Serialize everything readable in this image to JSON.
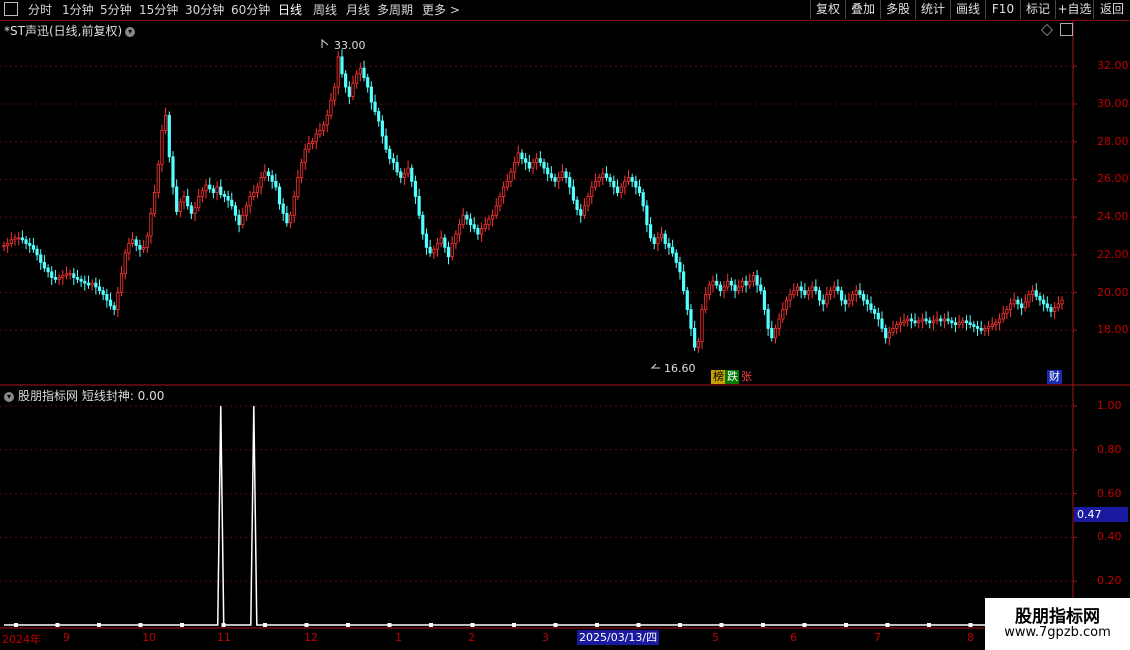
{
  "toolbar": {
    "left_items": [
      {
        "label": "分时",
        "active": false
      },
      {
        "label": "1分钟",
        "active": false
      },
      {
        "label": "5分钟",
        "active": false
      },
      {
        "label": "15分钟",
        "active": false
      },
      {
        "label": "30分钟",
        "active": false
      },
      {
        "label": "60分钟",
        "active": false
      },
      {
        "label": "日线",
        "active": true
      },
      {
        "label": "周线",
        "active": false
      },
      {
        "label": "月线",
        "active": false
      },
      {
        "label": "多周期",
        "active": false
      },
      {
        "label": "更多",
        "active": false
      }
    ],
    "right_buttons": [
      "复权",
      "叠加",
      "多股",
      "统计",
      "画线",
      "F10",
      "标记",
      "+自选",
      "返回"
    ]
  },
  "main_chart": {
    "title": "*ST声迅(日线,前复权)",
    "y_ticks": [
      "32.00",
      "30.00",
      "28.00",
      "26.00",
      "24.00",
      "22.00",
      "20.00",
      "18.00"
    ],
    "high_label": "33.00",
    "low_label": "16.60",
    "badge_bang": "榜",
    "badge_die": "跌",
    "badge_zhang": "张",
    "badge_cai": "财"
  },
  "indicator": {
    "title": "股朋指标网  短线封神: 0.00",
    "y_ticks": [
      "1.00",
      "0.80",
      "0.60",
      "0.40",
      "0.20"
    ],
    "current_value": "0.47"
  },
  "date_axis": {
    "labels": [
      "2024年",
      "9",
      "10",
      "11",
      "12",
      "1",
      "2",
      "3",
      "5",
      "6",
      "7",
      "8"
    ],
    "highlight": "2025/03/13/四"
  },
  "watermark": {
    "name": "股朋指标网",
    "url": "www.7gpzb.com"
  },
  "colors": {
    "up": "#ff3333",
    "down": "#54ffff",
    "grid": "#7a1010",
    "line": "#ffffff"
  },
  "chart_data": {
    "type": "candlestick",
    "ylim": [
      16.0,
      33.5
    ],
    "series": [
      {
        "name": "price",
        "values": [
          22.5,
          22.6,
          22.8,
          22.9,
          22.9,
          22.8,
          22.6,
          22.5,
          22.3,
          22.0,
          21.6,
          21.3,
          21.1,
          20.8,
          20.7,
          20.8,
          20.9,
          21.0,
          21.0,
          20.8,
          20.7,
          20.6,
          20.5,
          20.4,
          20.5,
          20.3,
          20.1,
          19.9,
          19.6,
          19.3,
          19.1,
          20.0,
          21.0,
          22.1,
          22.6,
          22.8,
          22.5,
          22.3,
          22.4,
          23.0,
          24.2,
          25.3,
          26.8,
          28.6,
          29.4,
          27.2,
          25.6,
          24.3,
          24.8,
          25.1,
          24.6,
          24.2,
          24.5,
          25.1,
          25.4,
          25.7,
          25.5,
          25.3,
          25.6,
          25.2,
          25.1,
          24.9,
          24.6,
          24.1,
          23.6,
          24.1,
          24.6,
          25.1,
          25.3,
          25.6,
          26.1,
          26.4,
          26.2,
          25.9,
          25.6,
          24.7,
          24.2,
          23.7,
          24.1,
          25.1,
          26.1,
          26.9,
          27.6,
          27.9,
          28.0,
          28.4,
          28.6,
          28.9,
          29.4,
          30.2,
          30.9,
          32.5,
          31.6,
          30.9,
          30.4,
          31.1,
          31.6,
          31.9,
          31.4,
          30.9,
          30.1,
          29.6,
          29.1,
          28.3,
          27.6,
          27.1,
          26.9,
          26.4,
          26.1,
          26.3,
          26.6,
          25.9,
          25.1,
          24.1,
          23.1,
          22.4,
          22.1,
          22.3,
          22.6,
          22.9,
          22.4,
          21.9,
          22.6,
          23.1,
          23.6,
          24.1,
          23.9,
          23.6,
          23.4,
          23.1,
          23.4,
          23.6,
          23.9,
          24.1,
          24.6,
          25.1,
          25.6,
          25.9,
          26.4,
          26.9,
          27.4,
          27.1,
          26.9,
          26.6,
          26.9,
          27.1,
          26.9,
          26.6,
          26.3,
          26.1,
          25.9,
          26.1,
          26.4,
          26.1,
          25.6,
          24.9,
          24.4,
          24.1,
          24.6,
          25.1,
          25.6,
          25.9,
          26.1,
          26.3,
          26.1,
          25.9,
          25.6,
          25.3,
          25.6,
          25.9,
          26.1,
          25.9,
          25.6,
          25.3,
          24.6,
          23.6,
          22.9,
          22.6,
          22.9,
          23.1,
          22.6,
          22.4,
          22.1,
          21.6,
          21.1,
          20.1,
          19.1,
          18.1,
          17.1,
          17.4,
          19.1,
          19.9,
          20.4,
          20.6,
          20.4,
          20.1,
          20.3,
          20.6,
          20.4,
          20.1,
          20.3,
          20.6,
          20.4,
          20.6,
          20.9,
          20.4,
          20.1,
          19.1,
          18.1,
          17.6,
          18.1,
          18.6,
          19.1,
          19.6,
          19.9,
          20.1,
          20.3,
          20.1,
          19.9,
          20.1,
          20.3,
          20.1,
          19.6,
          19.4,
          19.9,
          20.1,
          20.3,
          20.1,
          19.6,
          19.4,
          19.6,
          19.9,
          20.1,
          19.9,
          19.6,
          19.4,
          19.1,
          18.9,
          18.6,
          18.1,
          17.6,
          17.9,
          18.1,
          18.3,
          18.4,
          18.5,
          18.6,
          18.5,
          18.4,
          18.5,
          18.6,
          18.5,
          18.4,
          18.5,
          18.6,
          18.5,
          18.6,
          18.5,
          18.4,
          18.3,
          18.4,
          18.5,
          18.4,
          18.3,
          18.2,
          18.1,
          18.0,
          18.1,
          18.2,
          18.3,
          18.4,
          18.6,
          18.9,
          19.1,
          19.4,
          19.6,
          19.4,
          19.2,
          19.5,
          19.9,
          20.1,
          19.8,
          19.6,
          19.4,
          19.2,
          19.0,
          19.2,
          19.4,
          19.6
        ]
      }
    ]
  },
  "indicator_data": {
    "type": "line",
    "spikes": [
      {
        "index": 59,
        "value": 1.0
      },
      {
        "index": 68,
        "value": 1.0
      }
    ],
    "baseline": 0.0,
    "ylim": [
      0.0,
      1.0
    ]
  }
}
